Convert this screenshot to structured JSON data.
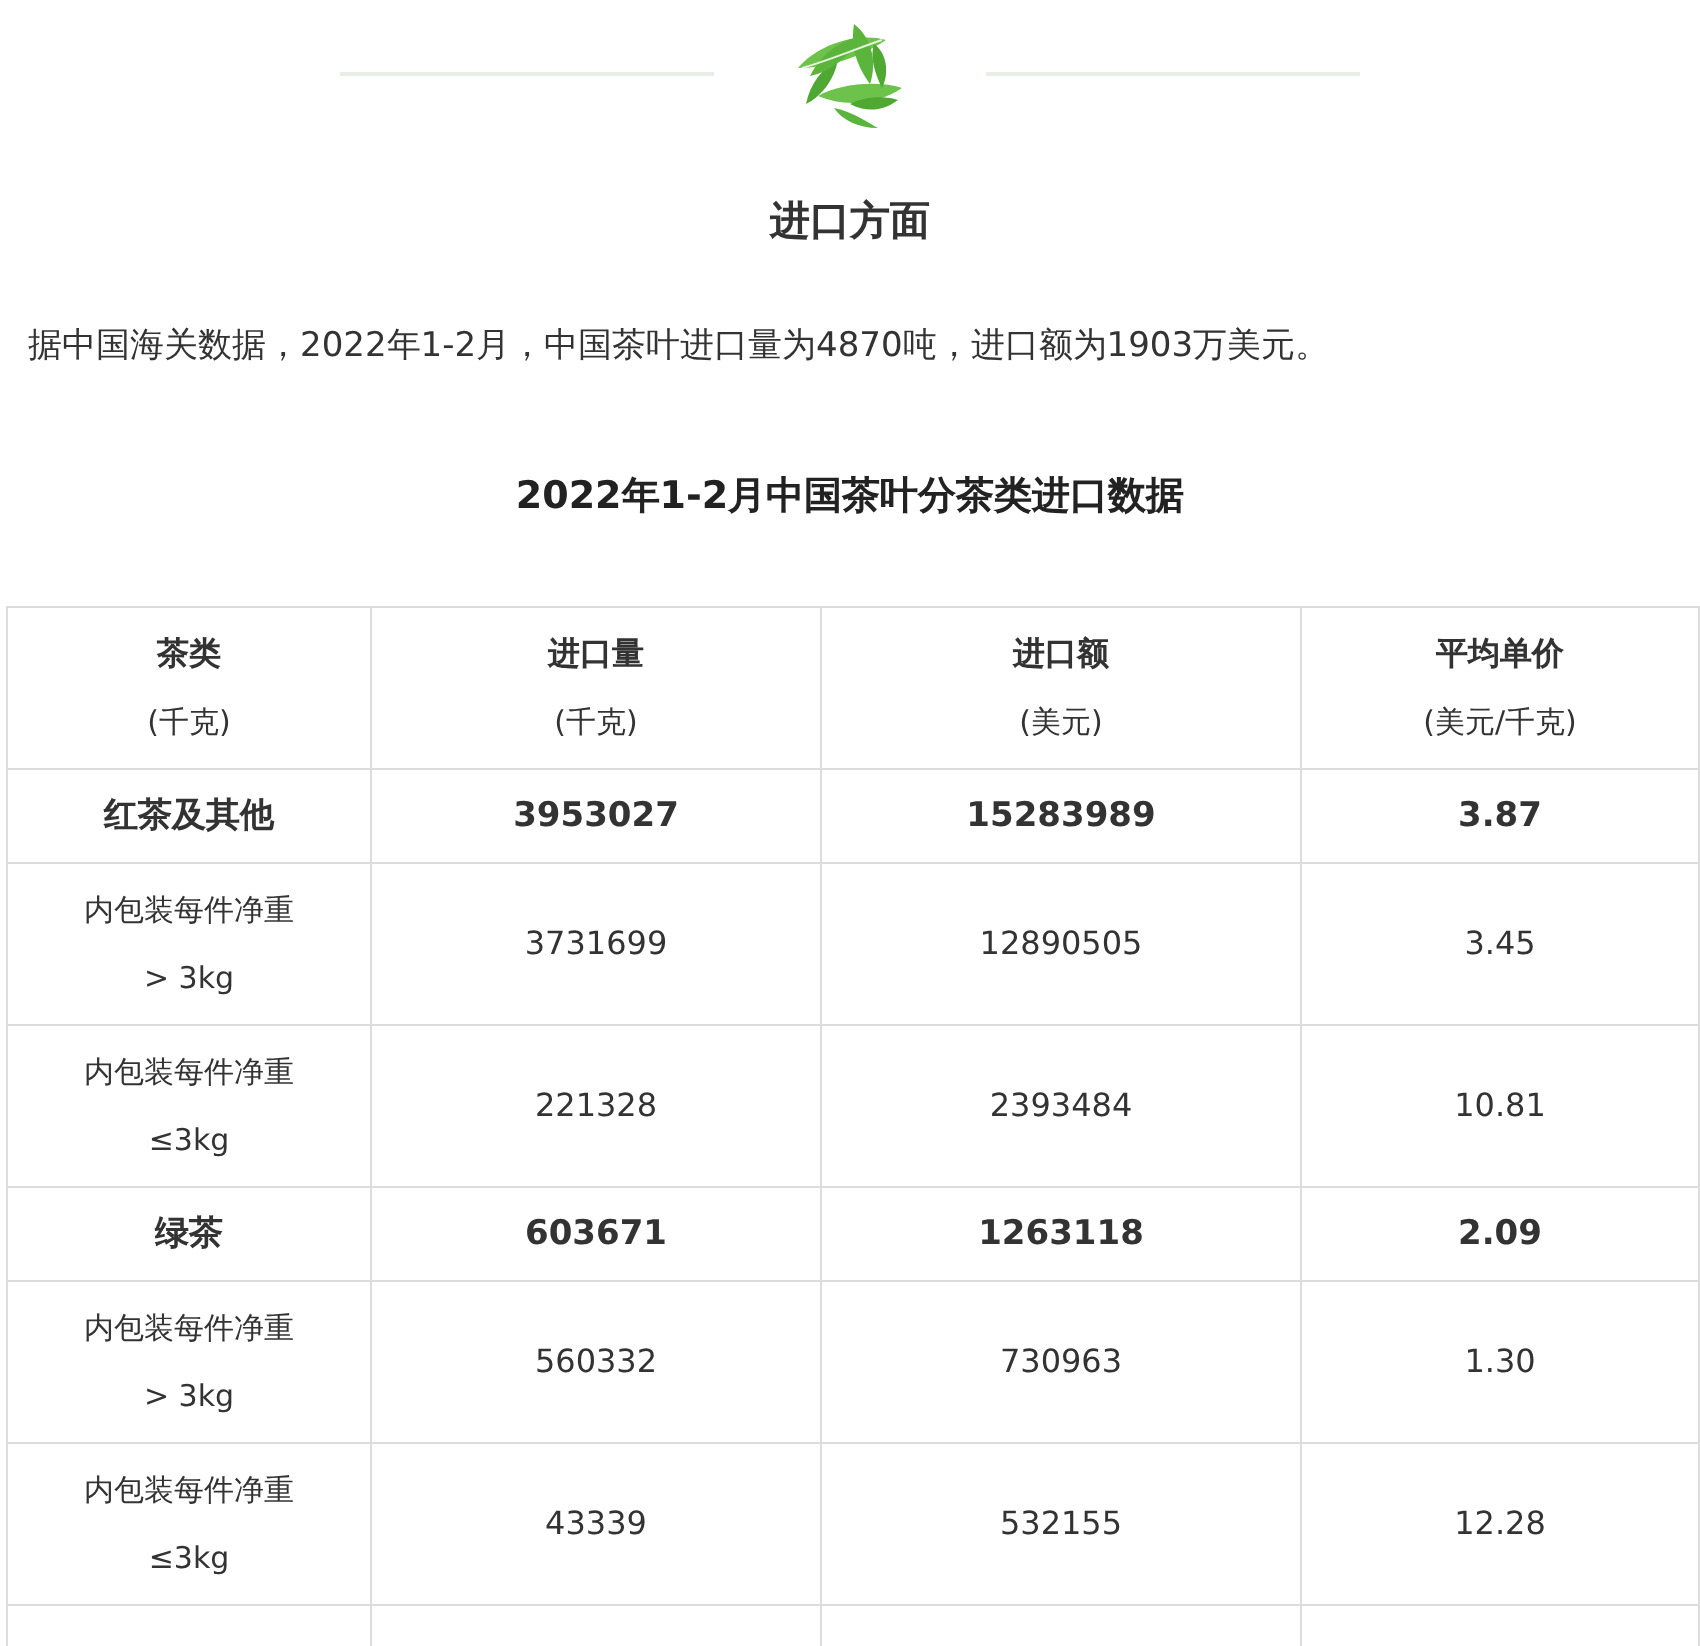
{
  "section_title": "进口方面",
  "intro": "据中国海关数据，2022年1-2月，中国茶叶进口量为4870吨，进口额为1903万美元。",
  "table": {
    "title": "2022年1-2月中国茶叶分茶类进口数据",
    "columns": [
      {
        "label": "茶类",
        "unit": "(千克)"
      },
      {
        "label": "进口量",
        "unit": "(千克)"
      },
      {
        "label": "进口额",
        "unit": "(美元)"
      },
      {
        "label": "平均单价",
        "unit": "(美元/千克)"
      }
    ],
    "rows": [
      {
        "kind": "category",
        "cells": [
          "红茶及其他",
          "3953027",
          "15283989",
          "3.87"
        ]
      },
      {
        "kind": "sub",
        "cells": [
          "内包装每件净重\n> 3kg",
          "3731699",
          "12890505",
          "3.45"
        ]
      },
      {
        "kind": "sub",
        "cells": [
          "内包装每件净重\n≤3kg",
          "221328",
          "2393484",
          "10.81"
        ]
      },
      {
        "kind": "category",
        "cells": [
          "绿茶",
          "603671",
          "1263118",
          "2.09"
        ]
      },
      {
        "kind": "sub",
        "cells": [
          "内包装每件净重\n> 3kg",
          "560332",
          "730963",
          "1.30"
        ]
      },
      {
        "kind": "sub",
        "cells": [
          "内包装每件净重\n≤3kg",
          "43339",
          "532155",
          "12.28"
        ]
      }
    ]
  }
}
